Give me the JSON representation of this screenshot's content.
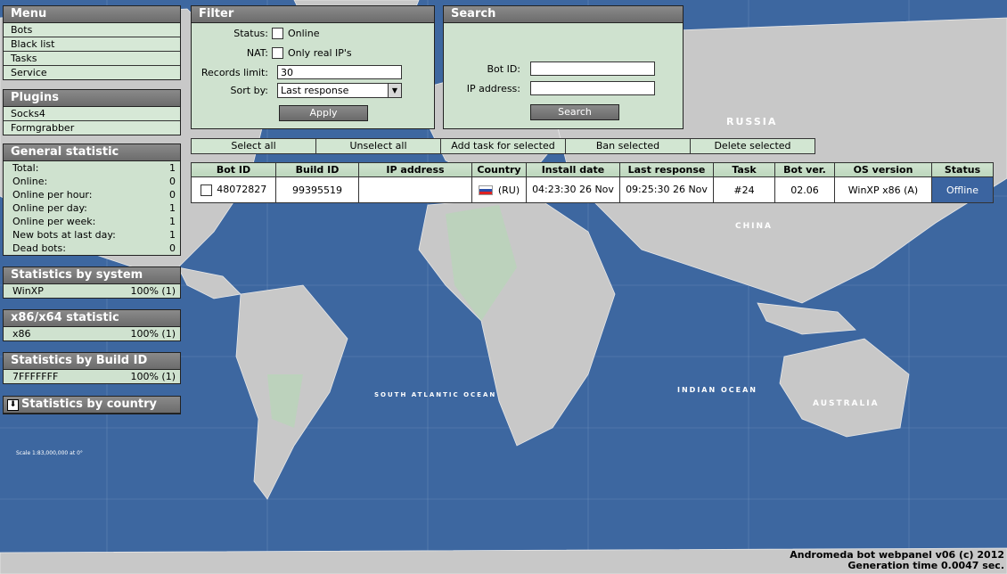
{
  "menu": {
    "title": "Menu",
    "items": [
      "Bots",
      "Black list",
      "Tasks",
      "Service"
    ]
  },
  "plugins": {
    "title": "Plugins",
    "items": [
      "Socks4",
      "Formgrabber"
    ]
  },
  "general_stats": {
    "title": "General statistic",
    "rows": [
      {
        "label": "Total:",
        "value": "1"
      },
      {
        "label": "Online:",
        "value": "0"
      },
      {
        "label": "Online per hour:",
        "value": "0"
      },
      {
        "label": "Online per day:",
        "value": "1"
      },
      {
        "label": "Online per week:",
        "value": "1"
      },
      {
        "label": "New bots at last day:",
        "value": "1"
      },
      {
        "label": "Dead bots:",
        "value": "0"
      }
    ]
  },
  "system_stats": {
    "title": "Statistics by system",
    "rows": [
      {
        "label": "WinXP",
        "value": "100% (1)"
      }
    ]
  },
  "arch_stats": {
    "title": "x86/x64 statistic",
    "rows": [
      {
        "label": "x86",
        "value": "100% (1)"
      }
    ]
  },
  "build_stats": {
    "title": "Statistics by Build ID",
    "rows": [
      {
        "label": "7FFFFFFF",
        "value": "100% (1)"
      }
    ]
  },
  "country_stats": {
    "title": "Statistics by country",
    "toggle_icon": "arrow-down-icon"
  },
  "filter": {
    "title": "Filter",
    "status_label": "Status:",
    "online_label": "Online",
    "nat_label": "NAT:",
    "real_ip_label": "Only real IP's",
    "records_label": "Records limit:",
    "records_value": "30",
    "sort_label": "Sort by:",
    "sort_value": "Last response",
    "apply_label": "Apply"
  },
  "search": {
    "title": "Search",
    "botid_label": "Bot ID:",
    "botid_value": "",
    "ip_label": "IP address:",
    "ip_value": "",
    "search_label": "Search"
  },
  "actions": [
    "Select all",
    "Unselect all",
    "Add task for selected",
    "Ban selected",
    "Delete selected"
  ],
  "table": {
    "headers": [
      "Bot ID",
      "Build ID",
      "IP address",
      "Country",
      "Install date",
      "Last response",
      "Task",
      "Bot ver.",
      "OS version",
      "Status"
    ],
    "rows": [
      {
        "bot_id": "48072827",
        "build_id": "99395519",
        "ip": "",
        "country": "(RU)",
        "install_date": "04:23:30 26 Nov",
        "last_response": "09:25:30 26 Nov",
        "task": "#24",
        "bot_ver": "02.06",
        "os": "WinXP x86 (A)",
        "status": "Offline"
      }
    ]
  },
  "footer": {
    "line1": "Andromeda bot webpanel v06 (c) 2012",
    "line2": "Generation time 0.0047 sec."
  },
  "map_labels": {
    "russia": "RUSSIA",
    "china": "CHINA",
    "australia": "AUSTRALIA",
    "indian_ocean": "INDIAN OCEAN",
    "atlantic": "SOUTH ATLANTIC OCEAN",
    "scale": "Scale 1:83,000,000 at 0°"
  },
  "colors": {
    "ocean": "#3d67a0",
    "land": "#c8c8c8",
    "panel": "#cfe2cf",
    "header": "#7a7a7a",
    "offline": "#3b64a0"
  }
}
